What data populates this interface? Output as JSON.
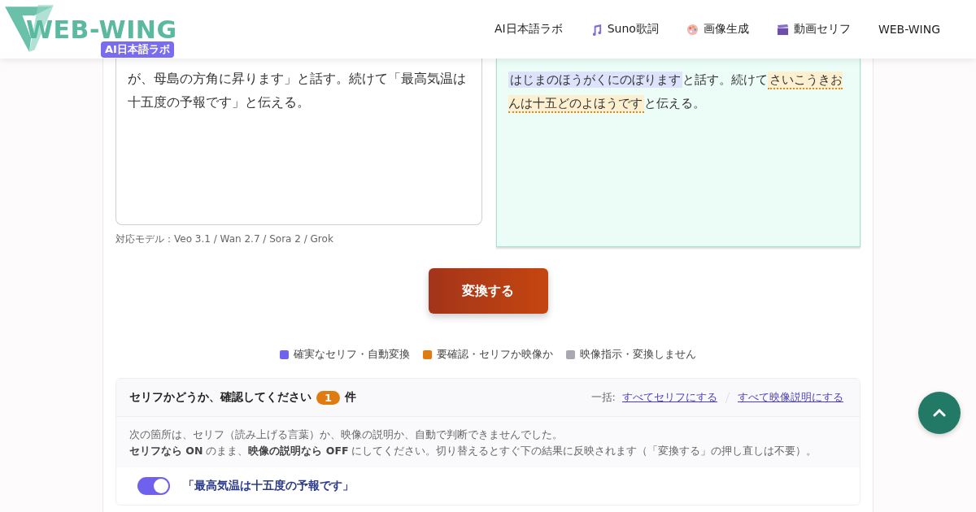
{
  "header": {
    "logo": "WEB-WING",
    "logo_badge": "AI日本語ラボ",
    "nav": [
      {
        "label": "AI日本語ラボ",
        "kind": "plain"
      },
      {
        "label": "Suno歌詞",
        "kind": "music"
      },
      {
        "label": "画像生成",
        "kind": "image"
      },
      {
        "label": "動画セリフ",
        "kind": "video"
      },
      {
        "label": "WEB-WING",
        "kind": "plain"
      }
    ]
  },
  "input": {
    "value": "が、母島の方角に昇ります」と話す。続けて「最高気温は十五度の予報です」と伝える。",
    "note": "対応モデル：Veo 3.1 / Wan 2.7 / Sora 2 / Grok"
  },
  "output": {
    "segments": [
      {
        "text": "はじまのほうがくにのぼります",
        "kind": "sure"
      },
      {
        "text": "と話す。続けて",
        "kind": "plain"
      },
      {
        "text": "さいこうきおんは十五どのよほうです",
        "kind": "check"
      },
      {
        "text": "と伝える。",
        "kind": "plain"
      }
    ]
  },
  "convert_button": "変換する",
  "legend": [
    {
      "label": "確実なセリフ・自動変換",
      "color": "#7062f0"
    },
    {
      "label": "要確認・セリフか映像か",
      "color": "#e07b12"
    },
    {
      "label": "映像指示・変換しません",
      "color": "#a9a8b2"
    }
  ],
  "review": {
    "title": "セリフかどうか、確認してください",
    "count": "1",
    "unit": "件",
    "bulk_label": "一括:",
    "bulk_links": [
      "すべてセリフにする",
      "すべて映像説明にする"
    ],
    "description": [
      "次の箇所は、セリフ（読み上げる言葉）か、映像の説明か、自動で判断できませんでした。",
      "**セリフなら ON** のまま、**映像の説明なら OFF** にしてください。切り替えるとすぐ下の結果に反映されます（「変換する」の押し直しは不要）。"
    ],
    "items": [
      {
        "text": "「最高気温は十五度の予報です」",
        "on": true
      }
    ]
  }
}
